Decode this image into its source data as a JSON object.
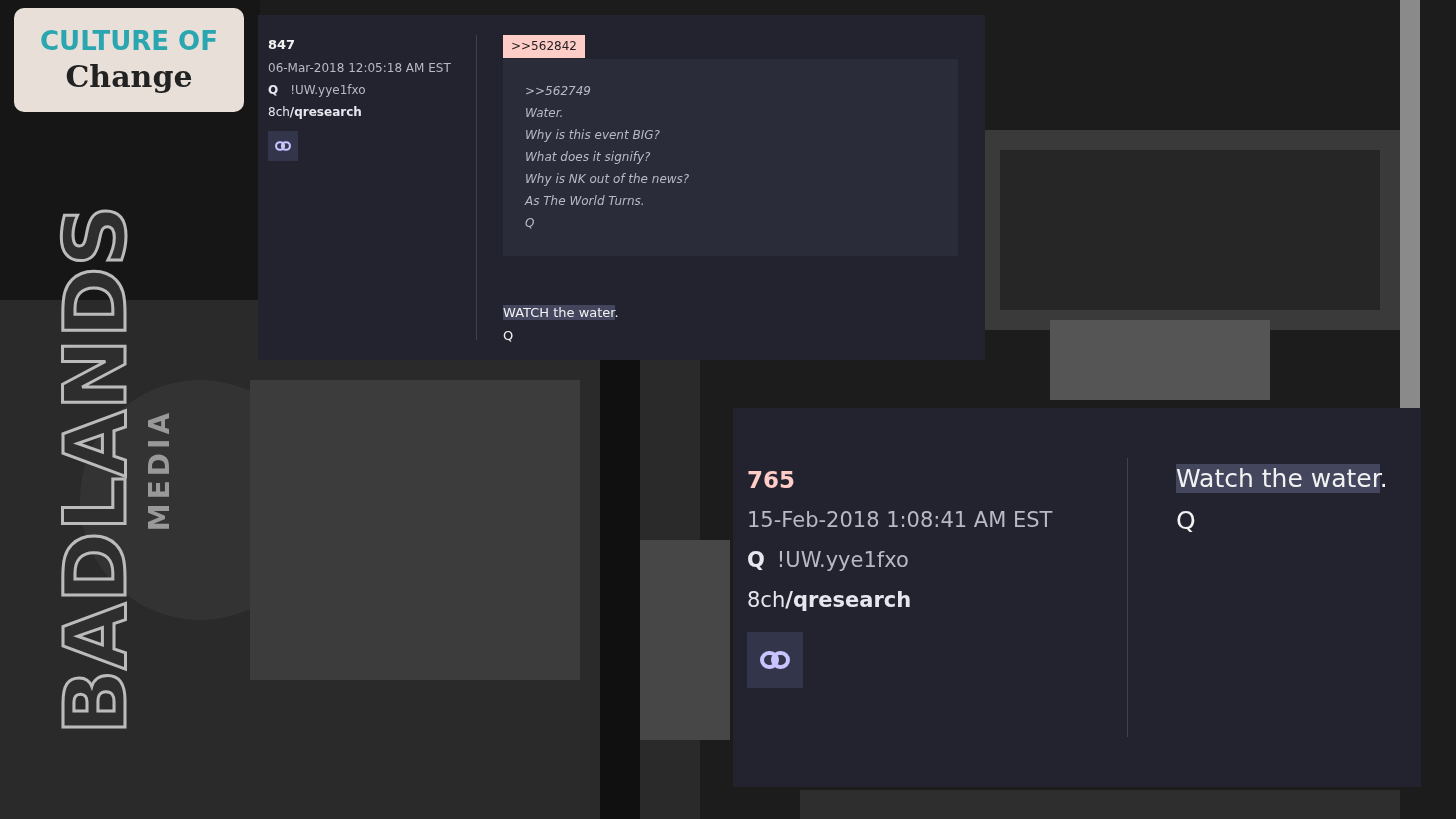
{
  "logo": {
    "top": "CULTURE OF",
    "bottom": "Change"
  },
  "brand": {
    "main": "BADLANDS",
    "sub": "MEDIA"
  },
  "posts": [
    {
      "number": "847",
      "date": "06-Mar-2018 12:05:18 AM EST",
      "author": "Q",
      "trip": "!UW.yye1fxo",
      "board": "8ch**/qresearch**",
      "reply_tag": ">>562842",
      "quote": [
        ">>562749",
        "Water.",
        "Why is this event BIG?",
        "What does it signify?",
        "Why is NK out of the news?",
        "As The World Turns.",
        "Q"
      ],
      "message": [
        {
          "highlight": "WATCH the water",
          "rest": "."
        },
        {
          "rest": "Q"
        }
      ]
    },
    {
      "number": "765",
      "date": "15-Feb-2018 1:08:41 AM EST",
      "author": "Q",
      "trip": "!UW.yye1fxo",
      "board": "8ch**/qresearch**",
      "message": [
        {
          "highlight": "Watch the water",
          "rest": "."
        },
        {
          "rest": "Q"
        }
      ]
    }
  ]
}
